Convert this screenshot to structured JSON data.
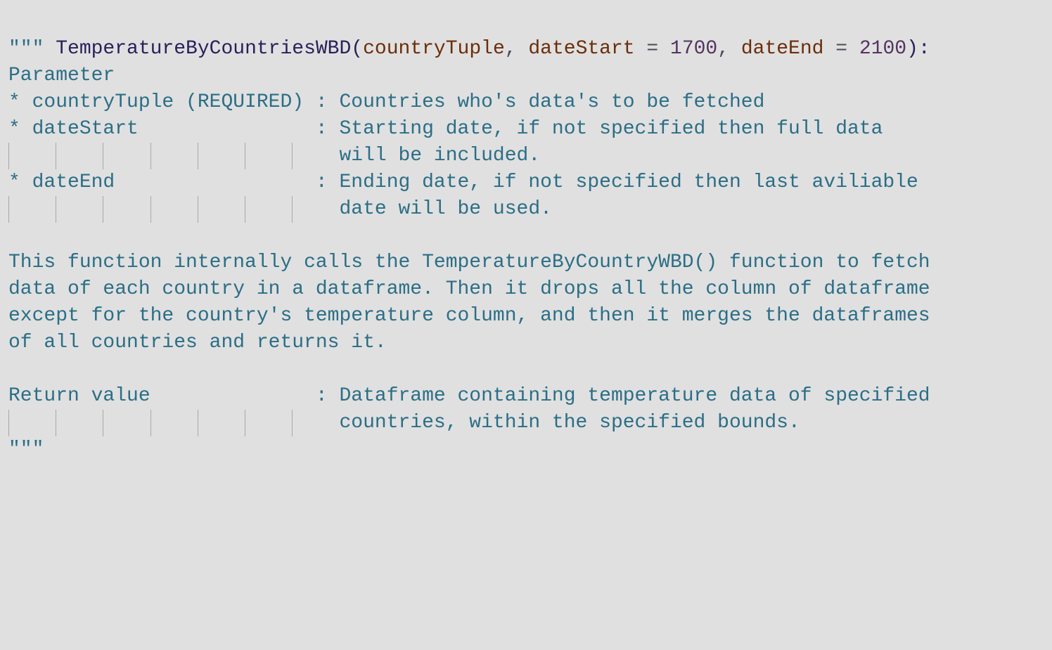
{
  "signature": {
    "function_name": "TemperatureByCountriesWBD",
    "open_paren": "(",
    "param1": "countryTuple",
    "comma1": ", ",
    "param2": "dateStart",
    "eq1": " = ",
    "default1": "1700",
    "comma2": ", ",
    "param3": "dateEnd",
    "eq2": " = ",
    "default2": "2100",
    "close": "):"
  },
  "docstring": {
    "open_quotes": "\"\"\"",
    "lines": [
      "Parameter",
      "* countryTuple (REQUIRED) : Countries who's data's to be fetched",
      "* dateStart               : Starting date, if not specified then full data",
      "                            will be included.",
      "* dateEnd                 : Ending date, if not specified then last aviliable",
      "                            date will be used.",
      "",
      "This function internally calls the TemperatureByCountryWBD() function to fetch",
      "data of each country in a dataframe. Then it drops all the column of dataframe",
      "except for the country's temperature column, and then it merges the dataframes",
      "of all countries and returns it.",
      "",
      "Return value              : Dataframe containing temperature data of specified",
      "                            countries, within the specified bounds."
    ],
    "close_quotes": "\"\"\""
  }
}
